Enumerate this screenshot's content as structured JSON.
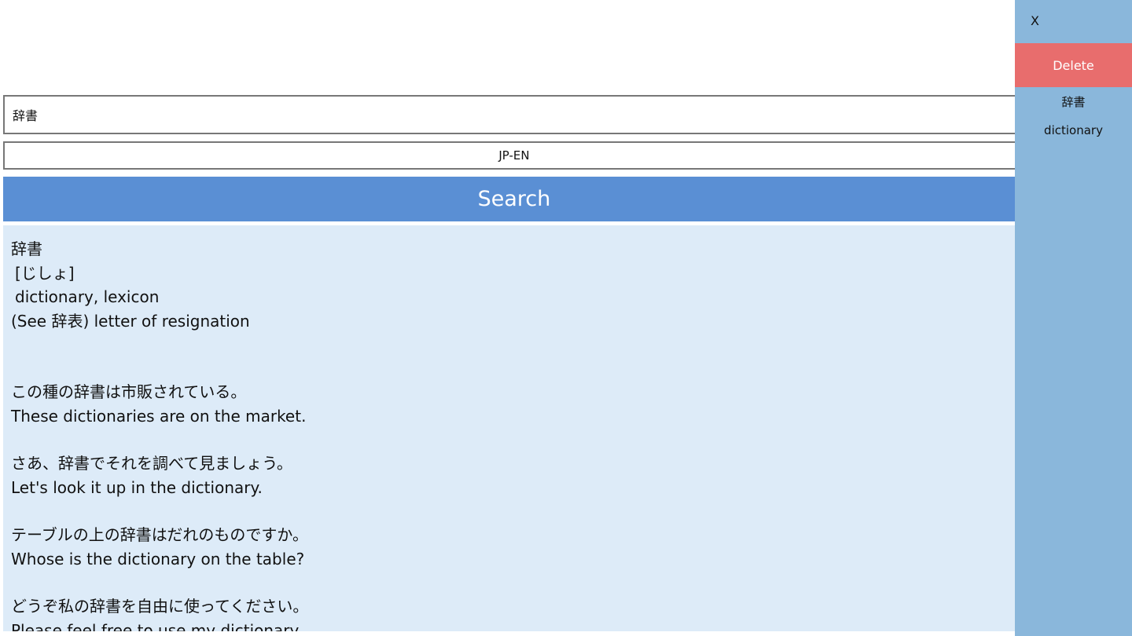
{
  "search": {
    "query": "辞書",
    "language": "JP-EN",
    "button_label": "Search"
  },
  "results": {
    "headword": "辞書",
    "reading": "[じしょ]",
    "meaning_1": "dictionary, lexicon",
    "meaning_2": "(See 辞表) letter of resignation",
    "examples": [
      {
        "jp": "この種の辞書は市販されている。",
        "en": "These dictionaries are on the market."
      },
      {
        "jp": "さあ、辞書でそれを調べて見ましょう。",
        "en": "Let's look it up in the dictionary."
      },
      {
        "jp": "テーブルの上の辞書はだれのものですか。",
        "en": "Whose is the dictionary on the table?"
      },
      {
        "jp": "どうぞ私の辞書を自由に使ってください。",
        "en": "Please feel free to use my dictionary."
      }
    ]
  },
  "side_panel": {
    "close_label": "X",
    "delete_label": "Delete",
    "history": [
      "辞書",
      "dictionary"
    ]
  },
  "colors": {
    "search_button": "#5a8fd4",
    "results_background": "#ddebf8",
    "side_panel": "#8ab7db",
    "delete_button": "#e86d6d"
  }
}
